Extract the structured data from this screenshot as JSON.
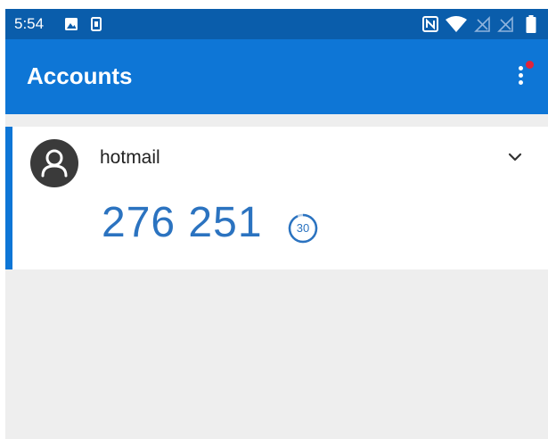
{
  "status_bar": {
    "time": "5:54",
    "left_icons": [
      "image-icon",
      "sim-icon"
    ],
    "right_icons": [
      "nfc-icon",
      "wifi-icon",
      "signal-off-icon",
      "signal-off-icon",
      "battery-icon"
    ]
  },
  "app_bar": {
    "title": "Accounts",
    "menu_icon": "more-vertical-icon",
    "notification_color": "#e0243a"
  },
  "accounts": [
    {
      "name": "hotmail",
      "code": "276 251",
      "timer_seconds": "30",
      "avatar_icon": "person-icon",
      "expand_icon": "chevron-down-icon"
    }
  ],
  "colors": {
    "status_bar": "#0a5dab",
    "app_bar": "#0e76d6",
    "accent": "#0e76d6",
    "code_text": "#2b73c0",
    "background": "#eeeeee"
  }
}
